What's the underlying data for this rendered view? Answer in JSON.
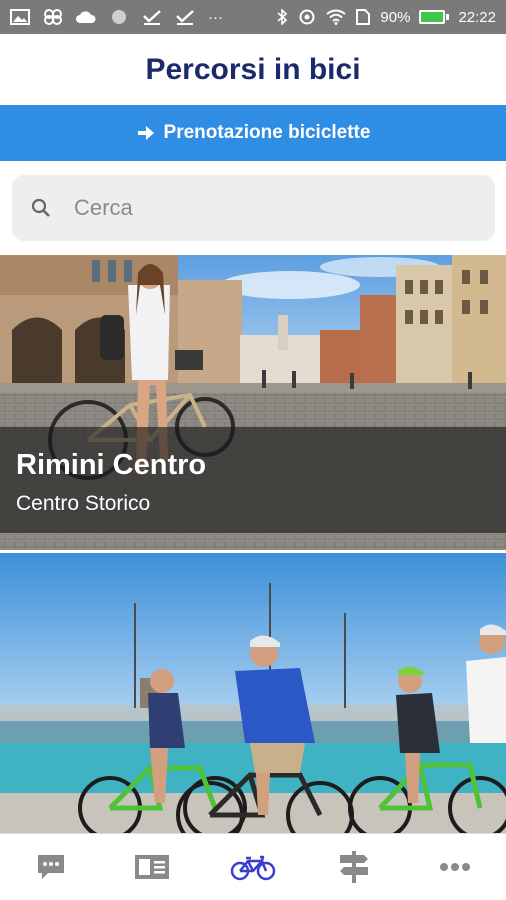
{
  "status_bar": {
    "battery_percent": "90%",
    "time": "22:22",
    "overflow": "···",
    "icons": [
      "gallery-icon",
      "app-icon",
      "cloud-icon",
      "circle-icon",
      "check-icon",
      "check-icon",
      "bluetooth-icon",
      "sync-icon",
      "wifi-icon",
      "sim-icon",
      "battery-icon"
    ]
  },
  "header": {
    "title": "Percorsi in bici"
  },
  "booking_button": {
    "label": "Prenotazione biciclette",
    "icon": "arrow-right-icon",
    "color": "#2f8de4"
  },
  "search": {
    "placeholder": "Cerca",
    "value": ""
  },
  "routes": [
    {
      "name": "Rimini Centro",
      "subtitle": "Centro Storico"
    },
    {
      "name": "",
      "subtitle": ""
    }
  ],
  "bottom_nav": {
    "items": [
      "chat-icon",
      "id-card-icon",
      "bicycle-icon",
      "signpost-icon",
      "more-icon"
    ],
    "active": "bicycle-icon",
    "active_color": "#3a3fd0",
    "inactive_color": "#8a8a8a"
  },
  "colors": {
    "title": "#1a2a6c",
    "status_bar": "#7a7a7a"
  }
}
